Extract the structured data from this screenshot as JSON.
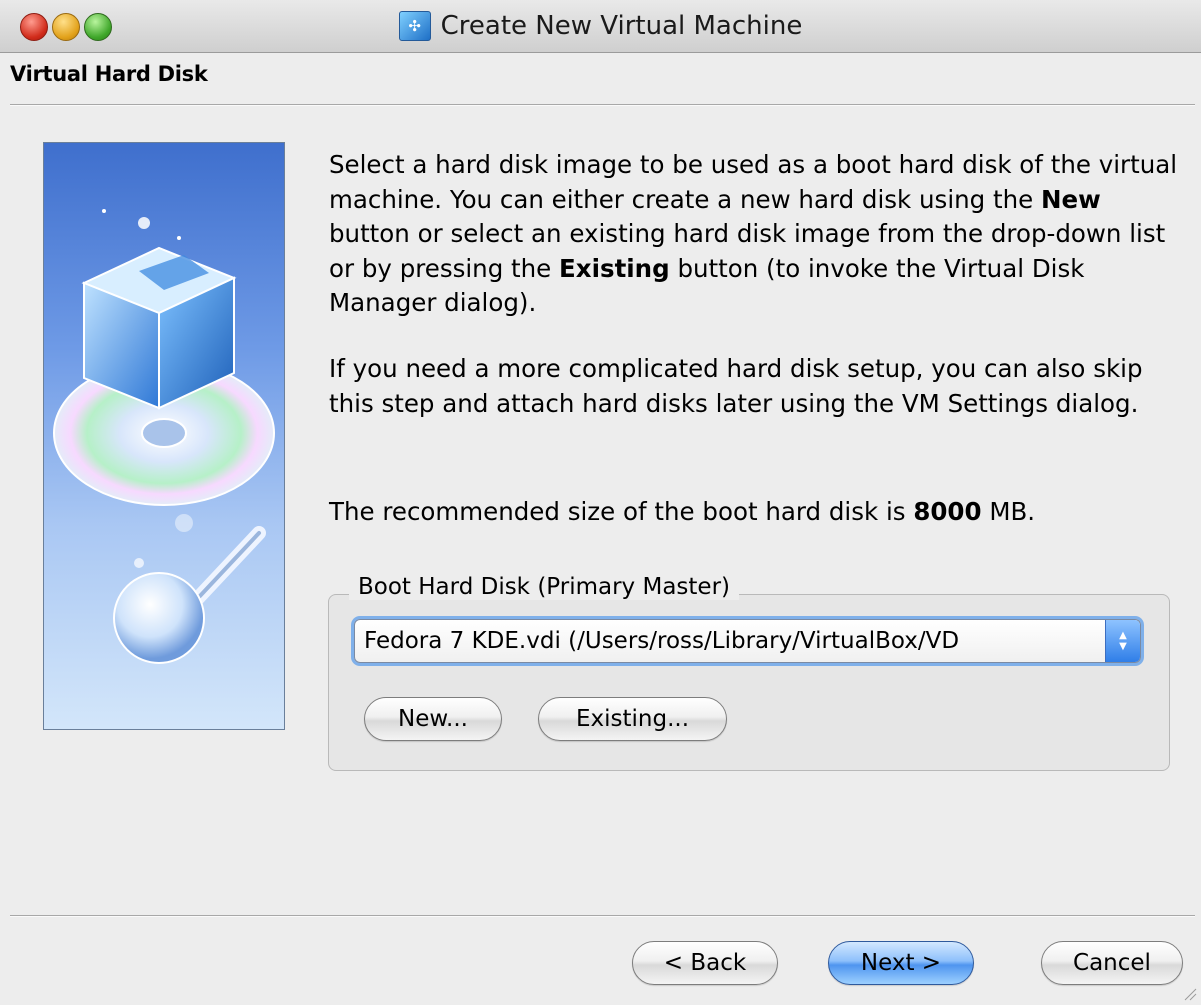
{
  "window": {
    "title": "Create New Virtual Machine",
    "icon": "virtualbox-app-icon"
  },
  "page": {
    "title": "Virtual Hard Disk"
  },
  "description": {
    "p1_parts": [
      "Select a hard disk image to be used as a boot hard disk of the virtual machine. You can either create a new hard disk using the ",
      "New",
      " button or select an existing hard disk image from the drop-down list or by pressing the ",
      "Existing",
      " button (to invoke the Virtual Disk Manager dialog)."
    ],
    "p2": "If you need a more complicated hard disk setup, you can also skip this step and attach hard disks later using the VM Settings dialog.",
    "p3_parts": [
      "The recommended size of the boot hard disk is ",
      "8000",
      " MB."
    ]
  },
  "boot_disk": {
    "legend": "Boot Hard Disk (Primary Master)",
    "selected": "Fedora 7 KDE.vdi (/Users/ross/Library/VirtualBox/VD",
    "new_label": "New...",
    "existing_label": "Existing..."
  },
  "footer": {
    "back_label": "< Back",
    "next_label": "Next >",
    "cancel_label": "Cancel"
  },
  "colors": {
    "accent": "#4f95ef",
    "window_bg": "#ededed"
  }
}
